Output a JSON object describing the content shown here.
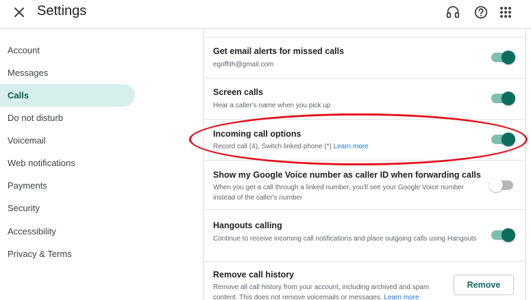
{
  "header": {
    "title": "Settings",
    "close_icon": "close-icon",
    "icons": [
      "headset-icon",
      "help-icon",
      "apps-grid-icon"
    ]
  },
  "sidebar": {
    "items": [
      {
        "label": "Account"
      },
      {
        "label": "Messages"
      },
      {
        "label": "Calls",
        "active": true
      },
      {
        "label": "Do not disturb"
      },
      {
        "label": "Voicemail"
      },
      {
        "label": "Web notifications"
      },
      {
        "label": "Payments"
      },
      {
        "label": "Security"
      },
      {
        "label": "Accessibility"
      },
      {
        "label": "Privacy & Terms"
      }
    ]
  },
  "settings": {
    "email_alerts": {
      "title": "Get email alerts for missed calls",
      "desc": "egriffith@gmail.com",
      "enabled": true
    },
    "screen_calls": {
      "title": "Screen calls",
      "desc": "Hear a caller's name when you pick up",
      "enabled": true
    },
    "incoming_call_options": {
      "title": "Incoming call options",
      "desc": "Record call (4), Switch linked phone (*)",
      "link": "Learn more",
      "enabled": true
    },
    "caller_id": {
      "title": "Show my Google Voice number as caller ID when forwarding calls",
      "desc": "When you get a call through a linked number, you'll see your Google Voice number instead of the caller's number",
      "enabled": false
    },
    "hangouts_calling": {
      "title": "Hangouts calling",
      "desc": "Continue to receive incoming call notifications and place outgoing calls using Hangouts",
      "enabled": true
    },
    "remove_history": {
      "title": "Remove call history",
      "desc": "Remove all call history from your account, including archived and spam content. This does not remove voicemails or messages.",
      "link": "Learn more",
      "button": "Remove"
    }
  },
  "colors": {
    "accent": "#0b6e5c",
    "active_nav_bg": "#d6efed",
    "annotation": "#e3121c",
    "link": "#1a73e8"
  }
}
